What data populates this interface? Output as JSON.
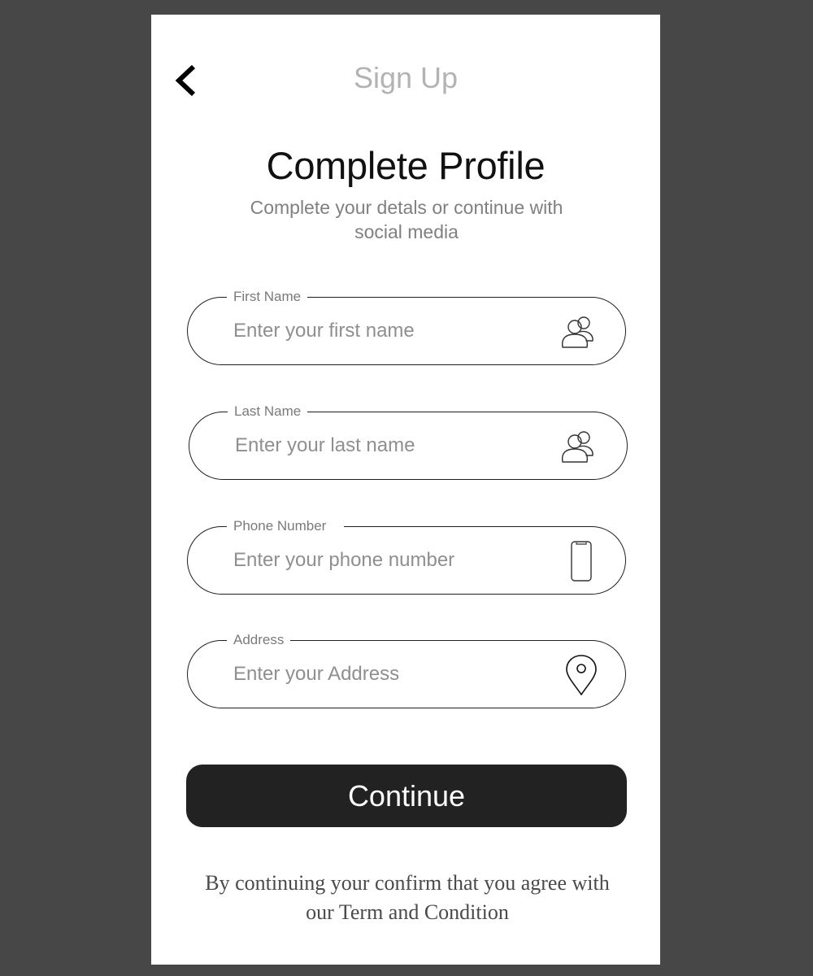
{
  "header": {
    "title": "Sign Up",
    "back_icon": "chevron-left-icon"
  },
  "page": {
    "title": "Complete Profile",
    "subtitle": "Complete your detals or continue with social media"
  },
  "form": {
    "fields": [
      {
        "label": "First Name",
        "placeholder": "Enter your first name",
        "value": "",
        "icon": "users-icon"
      },
      {
        "label": "Last Name",
        "placeholder": "Enter your last name",
        "value": "",
        "icon": "users-icon"
      },
      {
        "label": "Phone Number",
        "placeholder": "Enter your phone number",
        "value": "",
        "icon": "phone-icon"
      },
      {
        "label": "Address",
        "placeholder": "Enter your Address",
        "value": "",
        "icon": "location-pin-icon"
      }
    ],
    "continue_label": "Continue"
  },
  "footer": {
    "terms_text": "By continuing your confirm that you agree with our Term and Condition"
  },
  "colors": {
    "background": "#474747",
    "card": "#ffffff",
    "button": "#222222",
    "header_title": "#b3b3b3"
  }
}
